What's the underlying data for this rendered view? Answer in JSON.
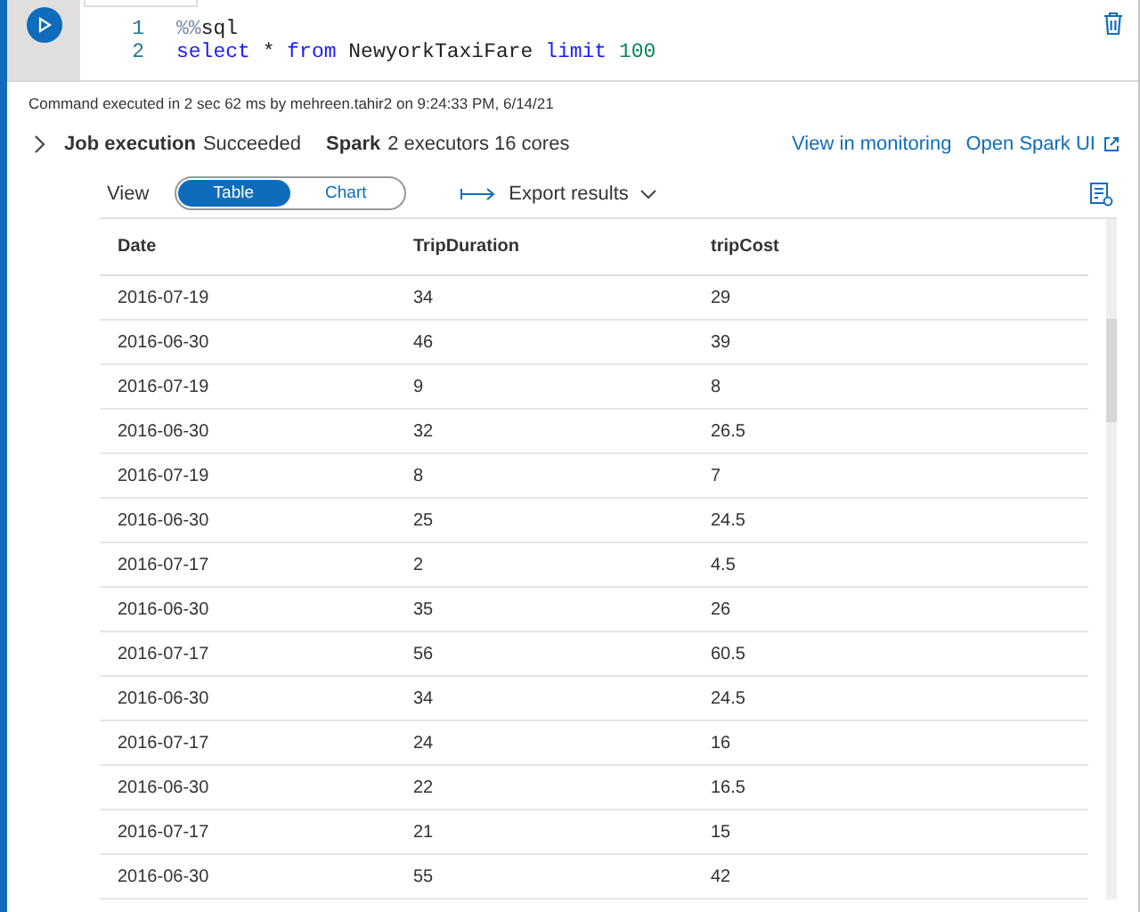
{
  "code": {
    "lines": [
      {
        "number": "1",
        "tokens": [
          {
            "kind": "magic",
            "text": "%%"
          },
          {
            "kind": "plain",
            "text": "sql"
          }
        ]
      },
      {
        "number": "2",
        "tokens": [
          {
            "kind": "keyword",
            "text": "select"
          },
          {
            "kind": "plain",
            "text": " * "
          },
          {
            "kind": "keyword",
            "text": "from"
          },
          {
            "kind": "plain",
            "text": " NewyorkTaxiFare "
          },
          {
            "kind": "keyword",
            "text": "limit"
          },
          {
            "kind": "number",
            "text": " 100"
          }
        ]
      }
    ]
  },
  "status": "Command executed in 2 sec 62 ms by mehreen.tahir2 on 9:24:33 PM, 6/14/21",
  "job": {
    "label": "Job execution",
    "state": "Succeeded",
    "spark_label": "Spark",
    "spark_info": "2 executors 16 cores",
    "links": [
      "View in monitoring",
      "Open Spark UI"
    ]
  },
  "view": {
    "label": "View",
    "tabs": [
      {
        "label": "Table",
        "selected": true
      },
      {
        "label": "Chart",
        "selected": false
      }
    ],
    "export": "Export results"
  },
  "table": {
    "columns": [
      "Date",
      "TripDuration",
      "tripCost"
    ],
    "rows": [
      [
        "2016-07-19",
        "34",
        "29"
      ],
      [
        "2016-06-30",
        "46",
        "39"
      ],
      [
        "2016-07-19",
        "9",
        "8"
      ],
      [
        "2016-06-30",
        "32",
        "26.5"
      ],
      [
        "2016-07-19",
        "8",
        "7"
      ],
      [
        "2016-06-30",
        "25",
        "24.5"
      ],
      [
        "2016-07-17",
        "2",
        "4.5"
      ],
      [
        "2016-06-30",
        "35",
        "26"
      ],
      [
        "2016-07-17",
        "56",
        "60.5"
      ],
      [
        "2016-06-30",
        "34",
        "24.5"
      ],
      [
        "2016-07-17",
        "24",
        "16"
      ],
      [
        "2016-06-30",
        "22",
        "16.5"
      ],
      [
        "2016-07-17",
        "21",
        "15"
      ],
      [
        "2016-06-30",
        "55",
        "42"
      ]
    ]
  }
}
